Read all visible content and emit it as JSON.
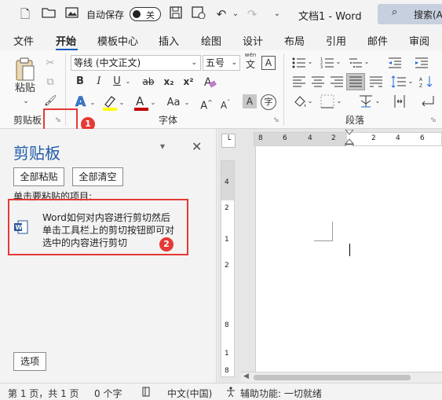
{
  "titlebar": {
    "autosave_label": "自动保存",
    "autosave_state": "关",
    "doc_title": "文档1 - Word",
    "search_label": "搜索(A"
  },
  "tabs": [
    "文件",
    "开始",
    "模板中心",
    "插入",
    "绘图",
    "设计",
    "布局",
    "引用",
    "邮件",
    "审阅"
  ],
  "ribbon": {
    "paste_label": "粘贴",
    "font_name": "等线 (中文正文)",
    "font_size": "五号",
    "wen_label": "wén",
    "wen_char": "文",
    "A_label": "A",
    "bold": "B",
    "italic": "I",
    "underline": "U",
    "strikethrough": "ab",
    "subscript": "x₂",
    "superscript": "x²",
    "clipboard_group": "剪贴板",
    "font_group": "字体",
    "paragraph_group": "段落",
    "marker1": "1"
  },
  "pane": {
    "title": "剪贴板",
    "paste_all": "全部粘贴",
    "clear_all": "全部清空",
    "instruction": "单击要粘贴的项目:",
    "item_line1": "Word如何对内容进行剪切然后",
    "item_line2": "单击工具栏上的剪切按钮即可对",
    "item_line3": "选中的内容进行剪切",
    "marker2": "2",
    "options": "选项"
  },
  "ruler": {
    "top_numbers": [
      "8",
      "6",
      "4",
      "2",
      "",
      "2",
      "4",
      "6"
    ],
    "side_numbers": [
      "4",
      "2",
      "1",
      "2",
      "8",
      "1",
      "8"
    ]
  },
  "statusbar": {
    "page": "第 1 页，共 1 页",
    "words": "0 个字",
    "language": "中文(中国)",
    "accessibility": "辅助功能: 一切就绪"
  },
  "colors": {
    "accent": "#185abd",
    "highlight_marker": "#e53935",
    "font_color_bar": "#c00000",
    "highlight_bar": "#ffff00"
  }
}
